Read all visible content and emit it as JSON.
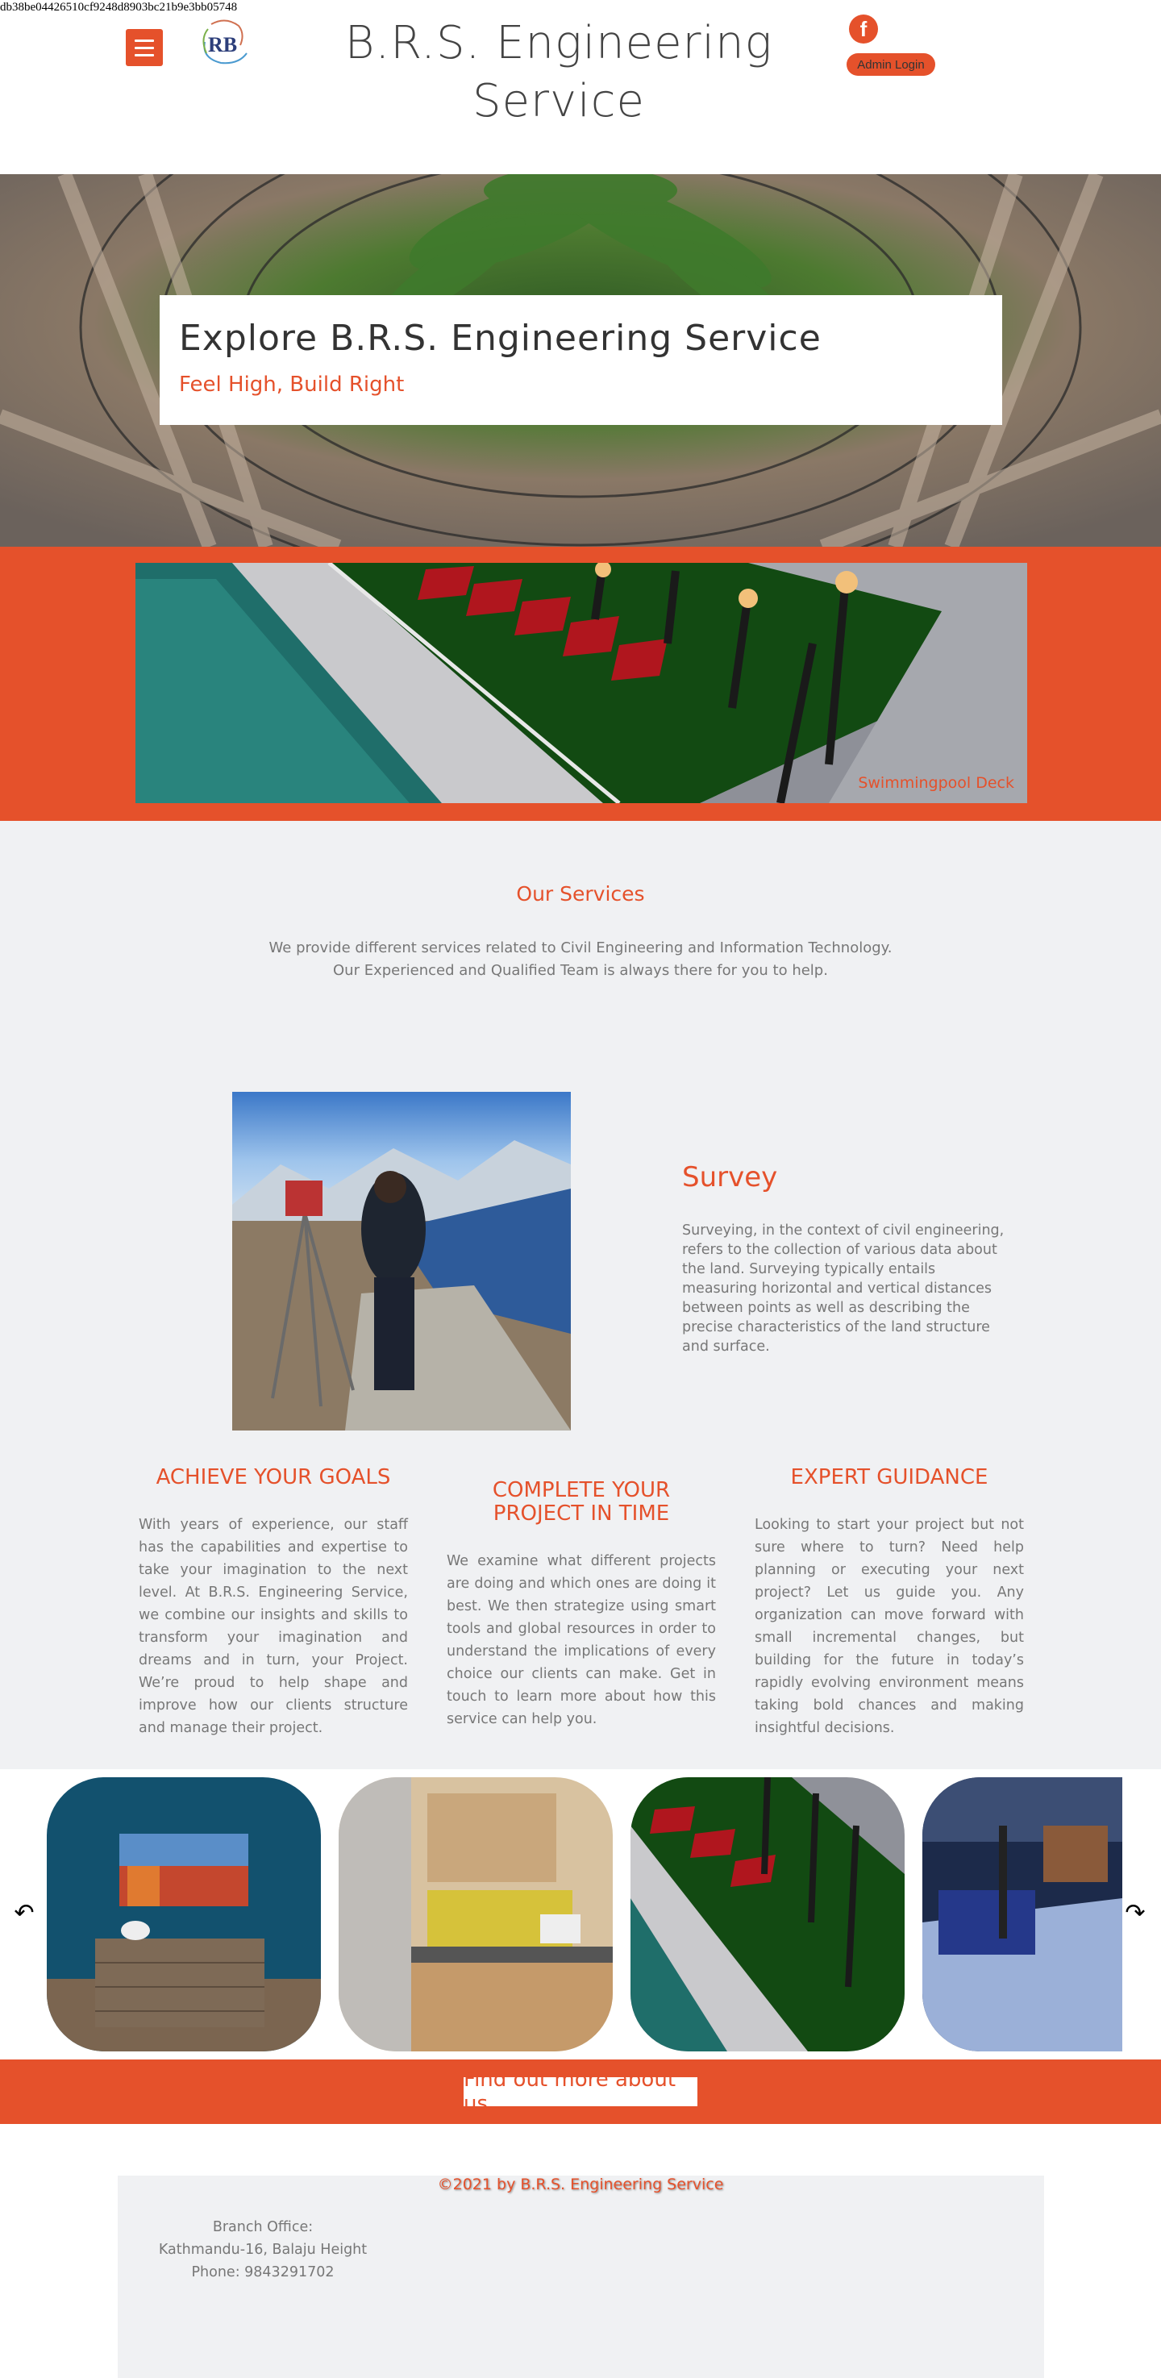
{
  "page_id": "db38be04426510cf9248d8903bc21b9e3bb05748",
  "header": {
    "menu_icon": "hamburger-icon",
    "logo_text": "RB",
    "site_title_line1": "B.R.S. Engineering",
    "site_title_line2": "Service",
    "social_icon": "facebook-icon",
    "social_glyph": "f",
    "admin_label": "Admin Login"
  },
  "hero": {
    "title": "Explore B.R.S. Engineering Service",
    "subtitle": "Feel High, Build Right"
  },
  "slideshow": {
    "caption": "Swimmingpool Deck"
  },
  "services": {
    "title": "Our Services",
    "desc_line1": "We provide different services related to Civil Engineering and Information Technology.",
    "desc_line2": "Our Experienced and Qualified Team is always there for you to help.",
    "featured": {
      "title": "Survey",
      "text": "Surveying, in the context of civil engineering, refers to the collection of various data about the land. Surveying typically entails measuring horizontal and vertical distances between points as well as describing the precise characteristics of the land structure and surface."
    },
    "columns": [
      {
        "title": "ACHIEVE YOUR GOALS",
        "text": "With years of experience, our staff has the capabilities and expertise to take your imagination to the next level. At B.R.S. Engineering Service, we combine our insights and skills to transform your imagination and dreams and in turn, your Project. We’re proud to help shape and improve how our clients structure and manage their project."
      },
      {
        "title": "COMPLETE YOUR PROJECT IN TIME",
        "text": "We examine what different projects are doing and which ones are doing it best. We then strategize using smart tools and global resources in order to understand the implications of every choice our clients can make. Get in touch to learn more about how this service can help you."
      },
      {
        "title": "EXPERT GUIDANCE",
        "text": "Looking to start your project but not sure where to turn? Need help planning or executing your next project? Let us guide you. Any organization can move forward with small incremental changes, but building for the future in today’s rapidly evolving environment means taking bold chances and making insightful decisions."
      }
    ]
  },
  "gallery": {
    "prev_icon": "arrow-left-icon",
    "next_icon": "arrow-right-icon",
    "prev_glyph": "↶",
    "next_glyph": "↷"
  },
  "cta": {
    "label": "Find out more about us."
  },
  "footer": {
    "copyright": "©2021 by B.R.S. Engineering Service",
    "branch_label": "Branch Office:",
    "branch_address": "Kathmandu-16, Balaju Height",
    "branch_phone": "Phone: 9843291702"
  },
  "colors": {
    "accent": "#e5512b",
    "section_bg": "#f0f1f3"
  }
}
